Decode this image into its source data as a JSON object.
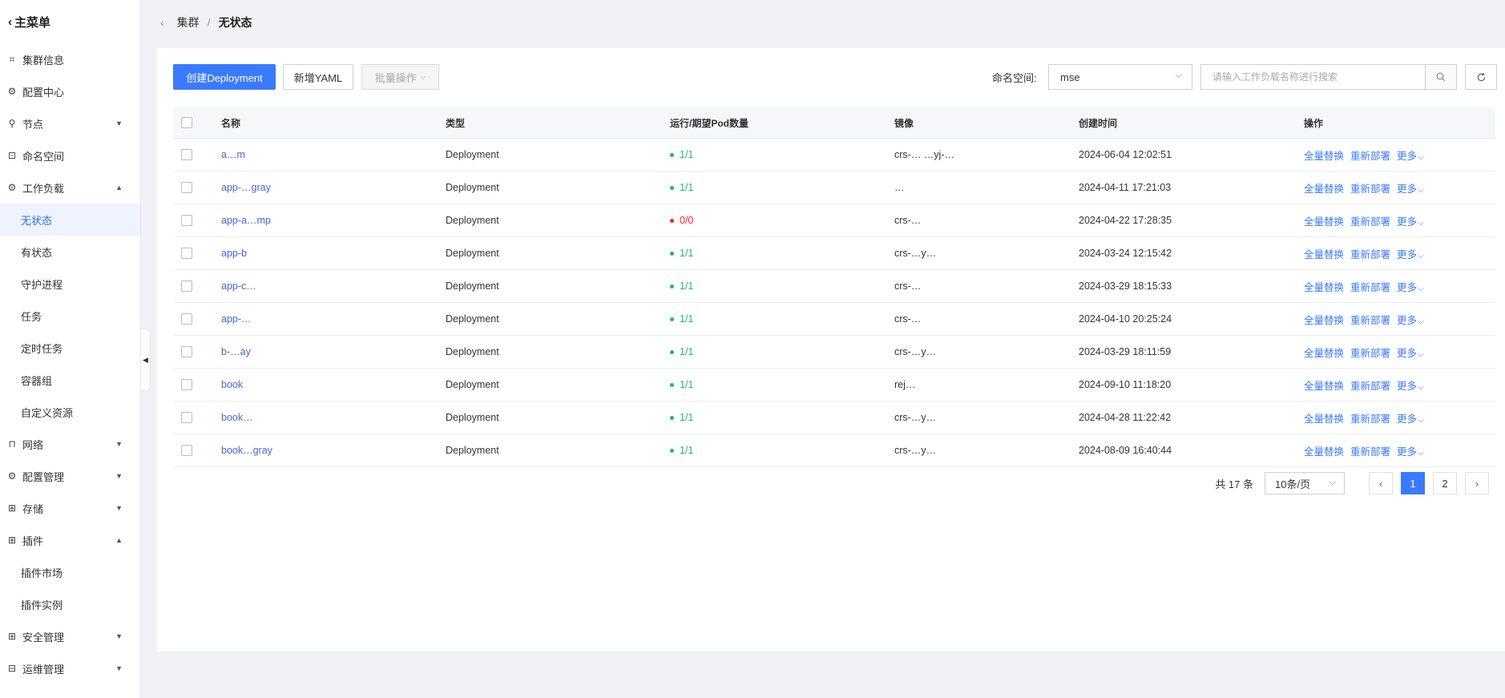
{
  "sidebar": {
    "title": "主菜单",
    "items": [
      {
        "label": "集群信息",
        "icon": "cluster-icon"
      },
      {
        "label": "配置中心",
        "icon": "config-center-icon"
      },
      {
        "label": "节点",
        "icon": "node-icon",
        "arrow": "▼"
      },
      {
        "label": "命名空间",
        "icon": "namespace-icon"
      },
      {
        "label": "工作负载",
        "icon": "workload-icon",
        "arrow": "▲"
      }
    ],
    "workload_sub": [
      "无状态",
      "有状态",
      "守护进程",
      "任务",
      "定时任务",
      "容器组",
      "自定义资源"
    ],
    "items2": [
      {
        "label": "网络",
        "icon": "network-icon",
        "arrow": "▼"
      },
      {
        "label": "配置管理",
        "icon": "config-manage-icon",
        "arrow": "▼"
      },
      {
        "label": "存储",
        "icon": "storage-icon",
        "arrow": "▼"
      },
      {
        "label": "插件",
        "icon": "plugin-icon",
        "arrow": "▲"
      }
    ],
    "plugin_sub": [
      "插件市场",
      "插件实例"
    ],
    "items3": [
      {
        "label": "安全管理",
        "icon": "security-icon",
        "arrow": "▼"
      },
      {
        "label": "运维管理",
        "icon": "ops-icon",
        "arrow": "▼"
      }
    ]
  },
  "breadcrumb": {
    "parent": "集群",
    "current": "无状态"
  },
  "toolbar": {
    "create_label": "创建Deployment",
    "yaml_label": "新增YAML",
    "batch_label": "批量操作",
    "namespace_label": "命名空间:",
    "namespace_value": "mse",
    "search_placeholder": "请输入工作负载名称进行搜索"
  },
  "table": {
    "headers": {
      "name": "名称",
      "type": "类型",
      "pods": "运行/期望Pod数量",
      "image": "镜像",
      "time": "创建时间",
      "ops": "操作"
    },
    "rows": [
      {
        "name": "a…m",
        "type": "Deployment",
        "pods": "1/1",
        "status": "ok",
        "image": "crs-… …yj-…",
        "time": "2024-06-04 12:02:51"
      },
      {
        "name": "app-…gray",
        "type": "Deployment",
        "pods": "1/1",
        "status": "ok",
        "image": "…",
        "time": "2024-04-11 17:21:03"
      },
      {
        "name": "app-a…mp",
        "type": "Deployment",
        "pods": "0/0",
        "status": "stopped",
        "image": "crs-…",
        "time": "2024-04-22 17:28:35"
      },
      {
        "name": "app-b",
        "type": "Deployment",
        "pods": "1/1",
        "status": "ok",
        "image": "crs-…y…",
        "time": "2024-03-24 12:15:42"
      },
      {
        "name": "app-c…",
        "type": "Deployment",
        "pods": "1/1",
        "status": "ok",
        "image": "crs-…",
        "time": "2024-03-29 18:15:33"
      },
      {
        "name": "app-…",
        "type": "Deployment",
        "pods": "1/1",
        "status": "ok",
        "image": "crs-…",
        "time": "2024-04-10 20:25:24"
      },
      {
        "name": "b-…ay",
        "type": "Deployment",
        "pods": "1/1",
        "status": "ok",
        "image": "crs-…y…",
        "time": "2024-03-29 18:11:59"
      },
      {
        "name": "book",
        "type": "Deployment",
        "pods": "1/1",
        "status": "ok",
        "image": "rej…",
        "time": "2024-09-10 11:18:20"
      },
      {
        "name": "book…",
        "type": "Deployment",
        "pods": "1/1",
        "status": "ok",
        "image": "crs-…y…",
        "time": "2024-04-28 11:22:42"
      },
      {
        "name": "book…gray",
        "type": "Deployment",
        "pods": "1/1",
        "status": "ok",
        "image": "crs-…y…",
        "time": "2024-08-09 16:40:44"
      }
    ],
    "ops": {
      "replace": "全量替换",
      "redeploy": "重新部署",
      "more": "更多"
    }
  },
  "pagination": {
    "total": "共 17 条",
    "page_size": "10条/页",
    "pages": [
      "1",
      "2"
    ],
    "current": "1"
  },
  "colors": {
    "primary": "#3a7afe",
    "status_ok": "#19be6b",
    "status_stopped": "#f5222d",
    "active_bg": "#eef3ff"
  }
}
